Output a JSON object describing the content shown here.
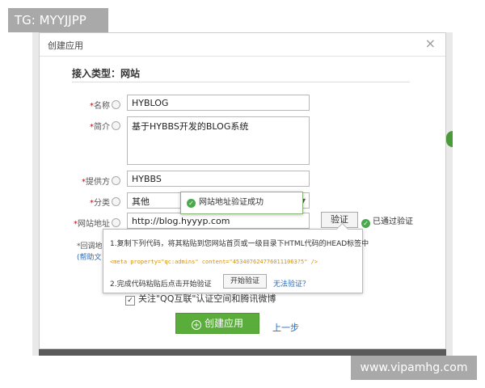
{
  "watermarks": {
    "top_left": "TG: MYYJJPP",
    "bottom_right": "www.vipamhg.com"
  },
  "dialog": {
    "title": "创建应用",
    "close": "×",
    "section_title": "接入类型：网站",
    "fields": {
      "name_label": "名称",
      "name_value": "HYBLOG",
      "intro_label": "简介",
      "intro_value": "基于HYBBS开发的BLOG系统",
      "provider_label": "提供方",
      "provider_value": "HYBBS",
      "category_label": "分类",
      "category_value": "其他",
      "site_label": "网站地址",
      "site_value": "http://blog.hyyyp.com",
      "required_mark": "*"
    },
    "verify_button": "验证",
    "verified_text": "已通过验证",
    "toast_text": "网站地址验证成功",
    "popup": {
      "step1": "1.复制下列代码，将其粘贴到您网站首页或一级目录下HTML代码的HEAD标签中",
      "meta_code": "<meta property=\"qc:admins\" content=\"4534076247760111063?5\" />",
      "step2": "2.完成代码粘贴后点击开始验证",
      "start_button": "开始验证",
      "cant_verify": "无法验证？"
    },
    "cutoff": {
      "callback_label": "*回调地",
      "help_link": "(帮助文"
    },
    "follow_text": "关注\"QQ互联\"认证空间和腾讯微博",
    "follow_check": "✓",
    "create_button": "创建应用",
    "create_icon": "+",
    "back_link": "上一步"
  }
}
